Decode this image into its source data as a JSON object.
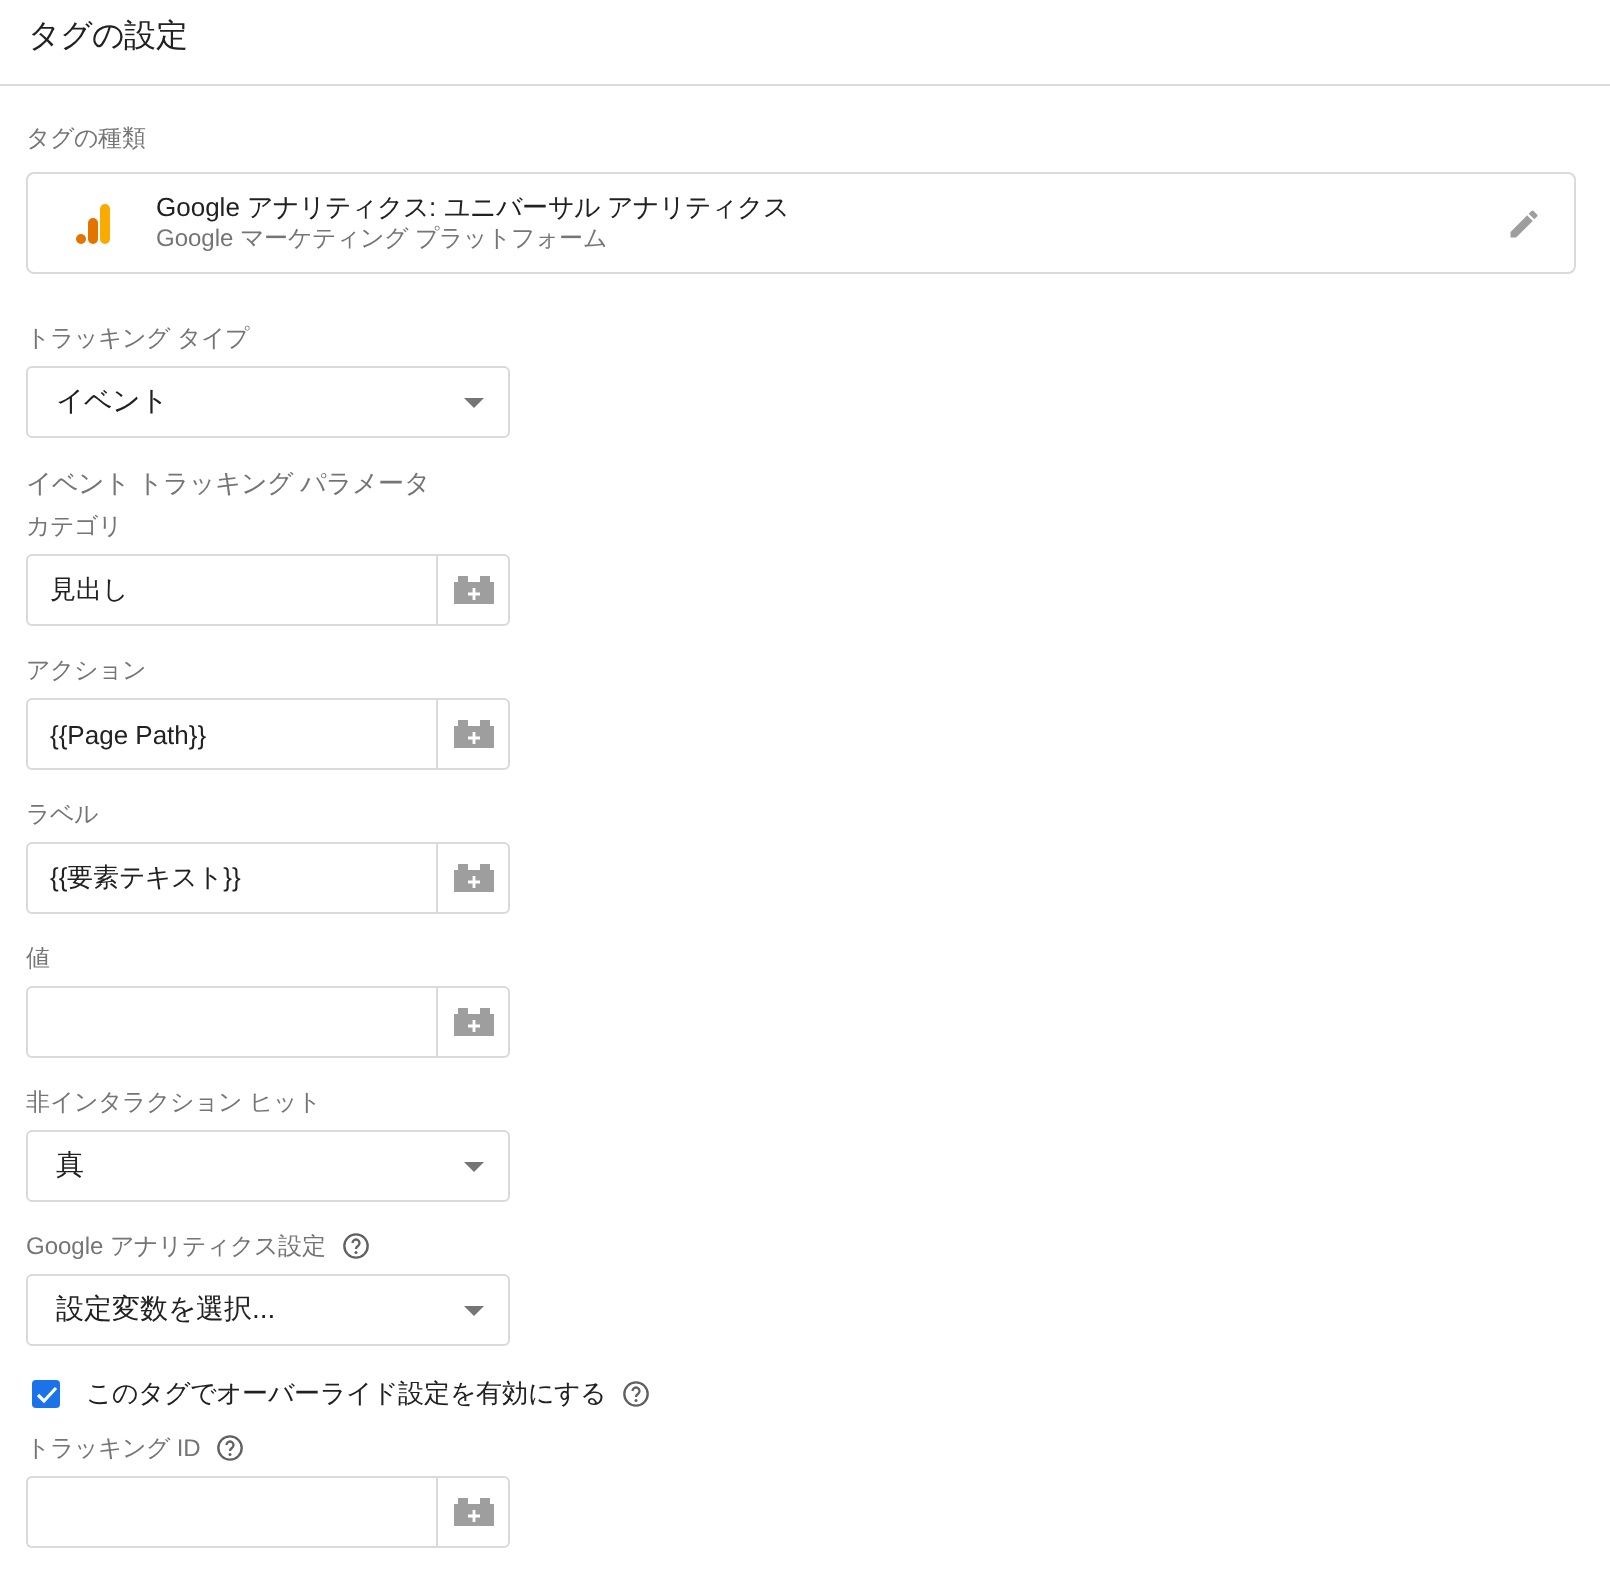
{
  "header": {
    "title": "タグの設定"
  },
  "tag_type": {
    "label": "タグの種類",
    "name": "Google アナリティクス: ユニバーサル アナリティクス",
    "platform": "Google マーケティング プラットフォーム"
  },
  "fields": [
    {
      "kind": "select",
      "label": "トラッキング タイプ",
      "help": false,
      "value": "イベント"
    },
    {
      "kind": "heading",
      "label": "イベント トラッキング パラメータ"
    },
    {
      "kind": "variable",
      "label": "カテゴリ",
      "help": false,
      "value": "見出し"
    },
    {
      "kind": "variable",
      "label": "アクション",
      "help": false,
      "value": "{{Page Path}}"
    },
    {
      "kind": "variable",
      "label": "ラベル",
      "help": false,
      "value": "{{要素テキスト}}"
    },
    {
      "kind": "variable",
      "label": "値",
      "help": false
    },
    {
      "kind": "select",
      "label": "非インタラクション ヒット",
      "help": false,
      "value": "真"
    },
    {
      "kind": "select",
      "label": "Google アナリティクス設定",
      "help": true,
      "value": "設定変数を選択..."
    },
    {
      "kind": "checkbox",
      "label": "このタグでオーバーライド設定を有効にする",
      "help": true,
      "checked": true
    },
    {
      "kind": "variable",
      "label": "トラッキング ID",
      "help": true
    }
  ]
}
